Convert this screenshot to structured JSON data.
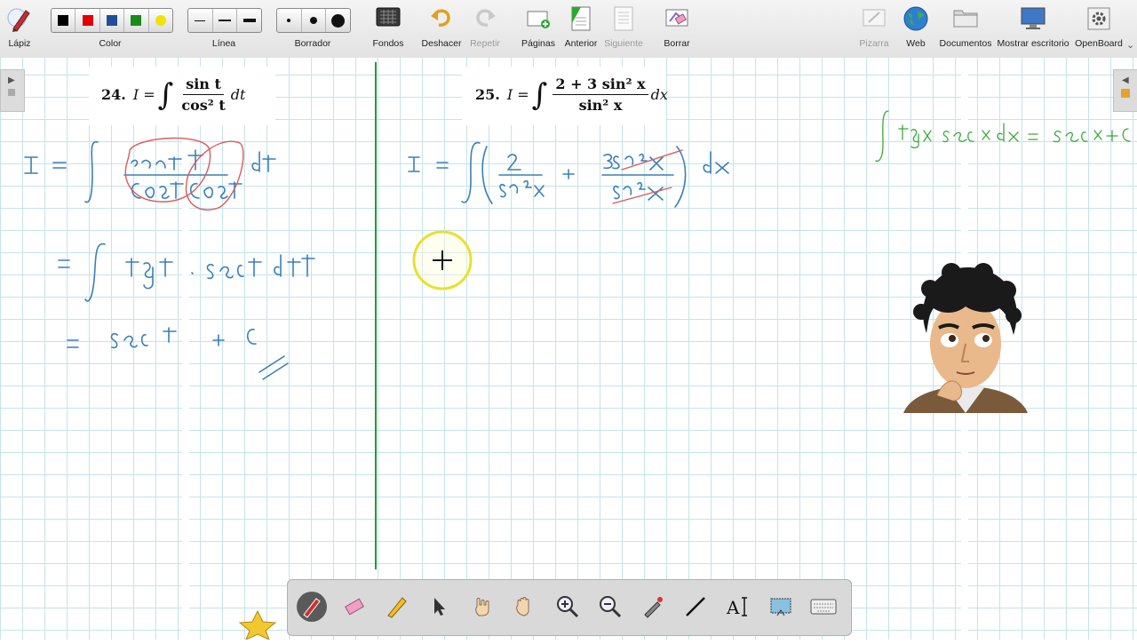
{
  "app": "OpenBoard",
  "toolbar": {
    "pencil_label": "Lápiz",
    "color_label": "Color",
    "line_label": "Línea",
    "eraser_label": "Borrador",
    "backgrounds_label": "Fondos",
    "undo_label": "Deshacer",
    "redo_label": "Repetir",
    "pages_label": "Páginas",
    "previous_label": "Anterior",
    "next_label": "Siguiente",
    "clear_label": "Borrar",
    "board_label": "Pizarra",
    "web_label": "Web",
    "documents_label": "Documentos",
    "show_desktop_label": "Mostrar escritorio",
    "openboard_label": "OpenBoard",
    "colors": [
      "#000000",
      "#e00000",
      "#1f4e9a",
      "#1a8a1a",
      "#f2e200"
    ]
  },
  "problem24": {
    "number": "24.",
    "lhs": "I =",
    "integral": "∫",
    "num": "sin t",
    "den": "cos² t",
    "diff": "dt"
  },
  "problem25": {
    "number": "25.",
    "lhs": "I =",
    "integral": "∫",
    "num": "2 + 3 sin² x",
    "den": "sin² x",
    "diff": "dx"
  },
  "colors": {
    "ink_blue": "#3a7fb5",
    "ink_red": "#d95a5a",
    "ink_green": "#3aa83a",
    "divider_green": "#1f9a3a",
    "grid": "#c5e3ea"
  }
}
